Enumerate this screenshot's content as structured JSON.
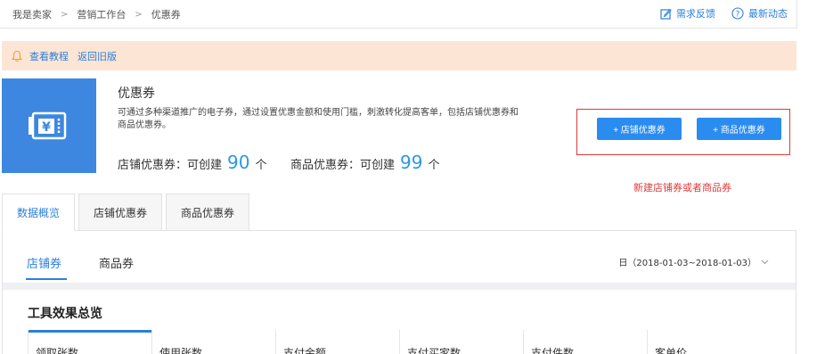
{
  "breadcrumb": [
    "我是卖家",
    "营销工作台",
    "优惠券"
  ],
  "header_links": {
    "feedback": "需求反馈",
    "news": "最新动态"
  },
  "notice": {
    "tutorial": "查看教程",
    "old_version": "返回旧版"
  },
  "hero": {
    "title": "优惠券",
    "description": "可通过多种渠道推广的电子券，通过设置优惠金额和使用门槛，刺激转化提高客单，包括店铺优惠券和商品优惠券。",
    "store_quota_label": "店铺优惠券：可创建",
    "store_quota_value": "90",
    "store_quota_unit": "个",
    "item_quota_label": "商品优惠券：可创建",
    "item_quota_value": "99",
    "item_quota_unit": "个"
  },
  "actions": {
    "store_coupon": "+ 店铺优惠券",
    "item_coupon": "+ 商品优惠券",
    "annotation": "新建店铺券或者商品券"
  },
  "main_tabs": [
    "数据概览",
    "店铺优惠券",
    "商品优惠券"
  ],
  "sub_tabs": [
    "店铺券",
    "商品券"
  ],
  "date_range": "日（2018-01-03~2018-01-03）",
  "section_title": "工具效果总览",
  "metrics": [
    "领取张数",
    "使用张数",
    "支付金额",
    "支付买家数",
    "支付件数",
    "客单价"
  ],
  "colors": {
    "accent": "#2b7fd9",
    "button": "#2b8cf0",
    "hero_bg": "#3d87e0",
    "notice_bg": "#fde5d5",
    "annotation": "#e03a3a"
  }
}
